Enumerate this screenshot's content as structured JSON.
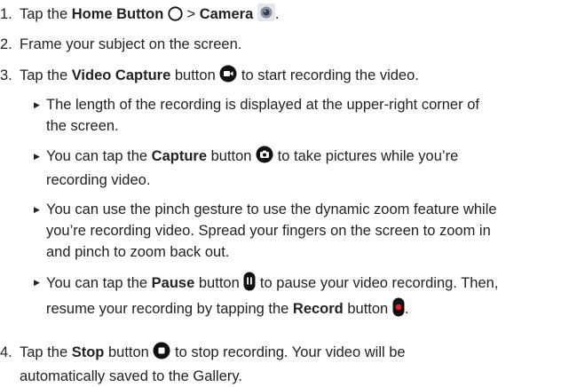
{
  "steps": {
    "s1": {
      "num": "1.",
      "a": "Tap the ",
      "b1": "Home Button",
      "c": " > ",
      "b2": "Camera",
      "d": "."
    },
    "s2": {
      "num": "2.",
      "text": "Frame your subject on the screen."
    },
    "s3": {
      "num": "3.",
      "a": "Tap the ",
      "b": "Video Capture",
      "c": " button ",
      "d": " to start recording the video."
    },
    "s4": {
      "num": "4.",
      "a": "Tap the ",
      "b": "Stop",
      "c": " button ",
      "d": " to stop recording. Your video will be",
      "line2": "automatically saved to the Gallery."
    }
  },
  "bullets": {
    "b1": {
      "line1": "The length of the recording is displayed at the upper-right corner of",
      "line2": "the screen."
    },
    "b2": {
      "a": "You can tap the ",
      "b": "Capture",
      "c": " button ",
      "d": " to take pictures while you’re",
      "line2": "recording video."
    },
    "b3": {
      "line1": "You can use the pinch gesture to use the dynamic zoom feature while",
      "line2": "you’re recording video. Spread your fingers on the screen to zoom in",
      "line3": "and pinch to zoom back out."
    },
    "b4": {
      "a": "You can tap the ",
      "b": "Pause",
      "c": " button ",
      "d": " to pause your video recording. Then,",
      "e": "resume your recording by tapping the ",
      "f": "Record",
      "g": " button ",
      "h": "."
    }
  },
  "colors": {
    "text": "#222222",
    "icon_dark": "#111111",
    "record_red": "#e0202a"
  }
}
